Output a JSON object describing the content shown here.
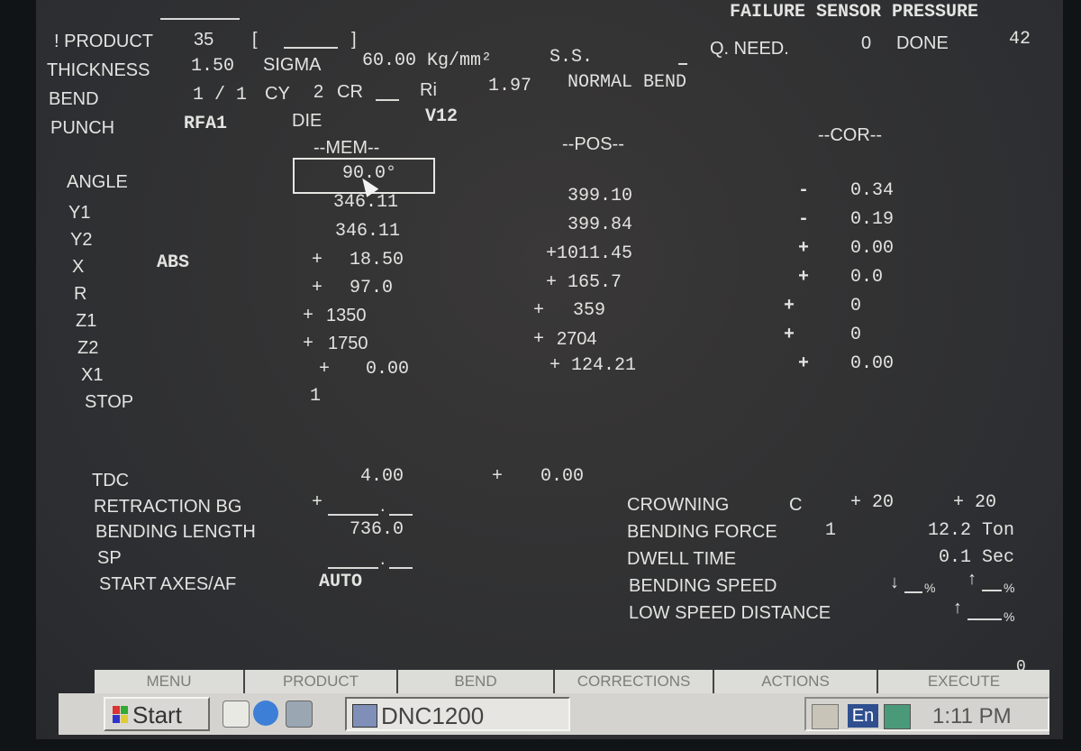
{
  "header": {
    "status_right": "FAILURE SENSOR PRESSURE",
    "product_label": "! PRODUCT",
    "product_value": "35",
    "product_bracket_open": "[",
    "product_bracket_close": "]",
    "q_need_label": "Q. NEED.",
    "q_need_value": "0",
    "done_label": "DONE",
    "done_value": "42",
    "thickness_label": "THICKNESS",
    "thickness_value": "1.50",
    "sigma_label": "SIGMA",
    "sigma_value": "60.00 Kg/mm²",
    "ss_label": "S.S.",
    "bend_label": "BEND",
    "bend_value": "1 / 1",
    "cy_label": "CY",
    "cy_value": "2",
    "cr_label": "CR",
    "ri_label": "Ri",
    "ri_value": "1.97",
    "bend_mode": "NORMAL BEND",
    "punch_label": "PUNCH",
    "punch_value": "RFA1",
    "die_label": "DIE",
    "die_value": "V12"
  },
  "columns": {
    "mem": "--MEM--",
    "pos": "--POS--",
    "cor": "--COR--"
  },
  "axes": [
    {
      "label": "ANGLE",
      "mem": "90.0°",
      "pos": "399.10",
      "cor_sign": "-",
      "cor": "0.34"
    },
    {
      "label": "Y1",
      "mem": "346.11",
      "pos": "",
      "cor_sign": "",
      "cor": ""
    },
    {
      "label": "Y2",
      "mem": "346.11",
      "pos": "399.84",
      "cor_sign": "-",
      "cor": "0.19"
    },
    {
      "label": "X",
      "extra": "ABS",
      "mem_sign": "+",
      "mem": "18.50",
      "pos": "+1011.45",
      "cor_sign": "+",
      "cor": "0.00"
    },
    {
      "label": "R",
      "mem_sign": "+",
      "mem": "97.0",
      "pos": "+ 165.7",
      "cor_sign": "+",
      "cor": "0.0"
    },
    {
      "label": "Z1",
      "mem_sign": "+",
      "mem": "1350",
      "pos_sign": "+",
      "pos": "359",
      "cor_sign": "+",
      "cor": "0"
    },
    {
      "label": "Z2",
      "mem_sign": "+",
      "mem": "1750",
      "pos_sign": "+",
      "pos": "2704",
      "cor_sign": "+",
      "cor": "0"
    },
    {
      "label": "X1",
      "mem_sign": "+",
      "mem": "0.00",
      "pos": "+ 124.21",
      "cor_sign": "+",
      "cor": "0.00"
    },
    {
      "label": "STOP",
      "mem": "1"
    }
  ],
  "lower": {
    "tdc_label": "TDC",
    "tdc_value": "4.00",
    "tdc_sign": "+",
    "tdc_value2": "0.00",
    "retraction_label": "RETRACTION BG",
    "retraction_sign": "+",
    "bending_length_label": "BENDING LENGTH",
    "bending_length_value": "736.0",
    "sp_label": "SP",
    "start_axes_label": "START AXES/AF",
    "start_axes_value": "AUTO",
    "crowning_label": "CROWNING",
    "crowning_mode": "C",
    "crowning_value1": "+ 20",
    "crowning_value2": "+ 20",
    "bending_force_label": "BENDING FORCE",
    "bending_force_index": "1",
    "bending_force_value": "12.2 Ton",
    "dwell_time_label": "DWELL TIME",
    "dwell_time_value": "0.1 Sec",
    "bending_speed_label": "BENDING SPEED",
    "low_speed_distance_label": "LOW SPEED DISTANCE",
    "corner_value": "0"
  },
  "softkeys": [
    "MENU",
    "PRODUCT",
    "BEND",
    "CORRECTIONS",
    "ACTIONS",
    "EXECUTE"
  ],
  "taskbar": {
    "start_label": "Start",
    "task_label": "DNC1200",
    "lang": "En",
    "clock": "1:11 PM"
  },
  "colors": {
    "screen_text": "#e3e3e1",
    "screen_bg": "#323233",
    "taskbar_bg": "#d4d3cf"
  }
}
